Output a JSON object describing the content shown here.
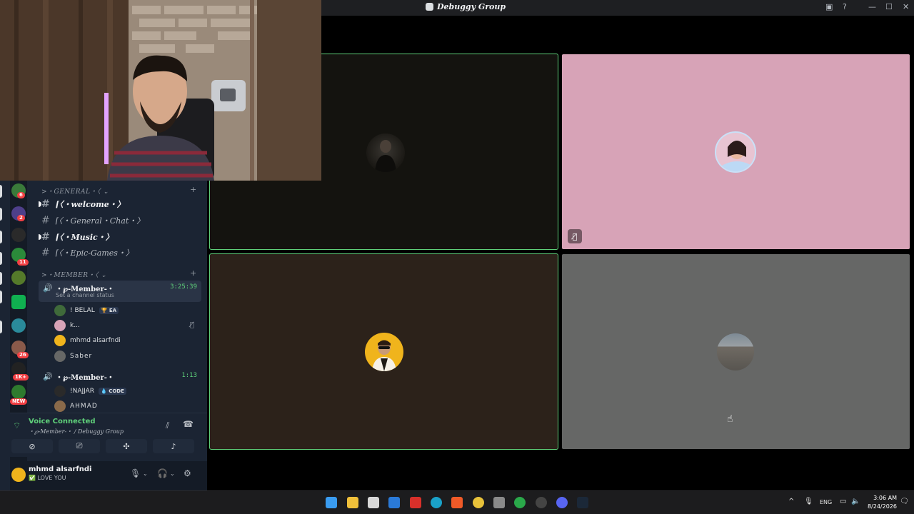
{
  "window": {
    "title": "Debuggy Group"
  },
  "colors": {
    "speaking_outline": "#5fd07a",
    "tile_dark": "#14130f",
    "tile_pink": "#d7a3b7",
    "tile_brown": "#2c221a",
    "tile_gray": "#666766",
    "sidebar_bg": "#1b2433"
  },
  "server_badges": [
    "6",
    "2",
    "11",
    "26",
    "1K+",
    "NEW"
  ],
  "categories": {
    "general": "GENERAL",
    "member": "MEMBER"
  },
  "channels": [
    {
      "name": "welcome",
      "bold": true
    },
    {
      "name": "General・Chat",
      "bold": false
    },
    {
      "name": "Music",
      "bold": true
    },
    {
      "name": "Epic-Games",
      "bold": false
    }
  ],
  "voice_channels": [
    {
      "label": "・℘-Member-・",
      "time": "3:25:39",
      "status": "Set a channel status",
      "members": [
        {
          "name": "! BELAL",
          "tag": "🏆 EA"
        },
        {
          "name": "k...",
          "tag": ""
        },
        {
          "name": "mhmd alsarfndi",
          "tag": ""
        },
        {
          "name": "Saber",
          "tag": ""
        }
      ]
    },
    {
      "label": "・℘-Member-・",
      "time": "1:13",
      "members": [
        {
          "name": "!NAJJAR",
          "tag": "💧 CODE"
        },
        {
          "name": "AHMAD",
          "tag": ""
        }
      ]
    }
  ],
  "voice_panel": {
    "status": "Voice Connected",
    "location": "・℘-Member-・ / Debuggy Group"
  },
  "user": {
    "name": "mhmd alsarfndi",
    "status": "✅ LOVE YOU"
  },
  "taskbar": {
    "language": "ENG",
    "time": "3:06 AM",
    "date": "8/24/2026"
  }
}
